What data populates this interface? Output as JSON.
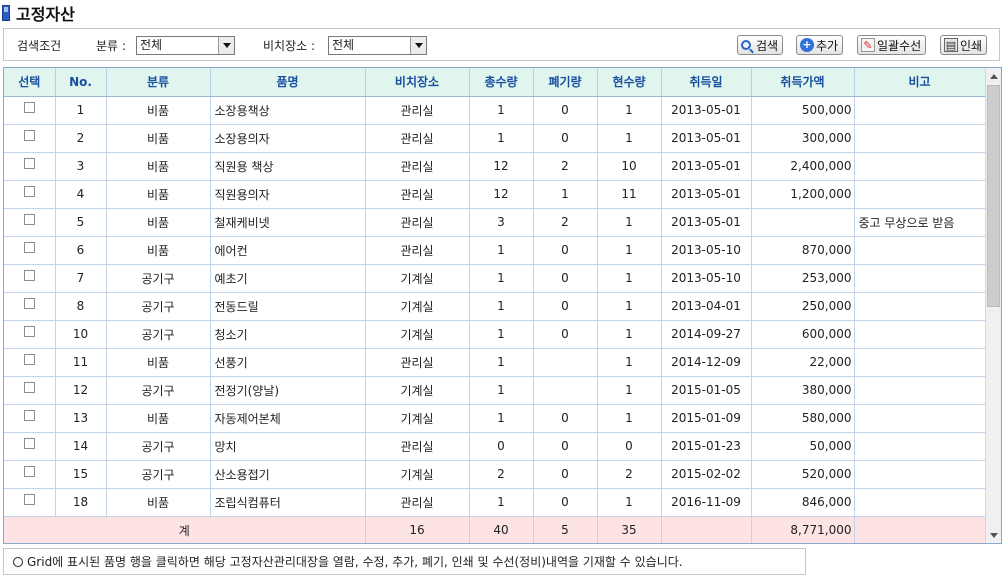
{
  "page": {
    "title": "고정자산"
  },
  "search": {
    "label": "검색조건",
    "category_label": "분류 :",
    "category_value": "전체",
    "location_label": "비치장소 :",
    "location_value": "전체"
  },
  "toolbar": {
    "search_label": "검색",
    "add_label": "추가",
    "bulk_edit_label": "일괄수선",
    "print_label": "인쇄"
  },
  "grid": {
    "columns": [
      "선택",
      "No.",
      "분류",
      "품명",
      "비치장소",
      "총수량",
      "폐기량",
      "현수량",
      "취득일",
      "취득가액",
      "비고"
    ],
    "rows": [
      {
        "no": "1",
        "category": "비품",
        "name": "소장용책상",
        "location": "관리실",
        "total": "1",
        "disposed": "0",
        "current": "1",
        "date": "2013-05-01",
        "price": "500,000",
        "note": ""
      },
      {
        "no": "2",
        "category": "비품",
        "name": "소장용의자",
        "location": "관리실",
        "total": "1",
        "disposed": "0",
        "current": "1",
        "date": "2013-05-01",
        "price": "300,000",
        "note": ""
      },
      {
        "no": "3",
        "category": "비품",
        "name": "직원용 책상",
        "location": "관리실",
        "total": "12",
        "disposed": "2",
        "current": "10",
        "date": "2013-05-01",
        "price": "2,400,000",
        "note": ""
      },
      {
        "no": "4",
        "category": "비품",
        "name": "직원용의자",
        "location": "관리실",
        "total": "12",
        "disposed": "1",
        "current": "11",
        "date": "2013-05-01",
        "price": "1,200,000",
        "note": ""
      },
      {
        "no": "5",
        "category": "비품",
        "name": "철재케비넷",
        "location": "관리실",
        "total": "3",
        "disposed": "2",
        "current": "1",
        "date": "2013-05-01",
        "price": "",
        "note": "중고 무상으로 받음"
      },
      {
        "no": "6",
        "category": "비품",
        "name": "에어컨",
        "location": "관리실",
        "total": "1",
        "disposed": "0",
        "current": "1",
        "date": "2013-05-10",
        "price": "870,000",
        "note": ""
      },
      {
        "no": "7",
        "category": "공기구",
        "name": "예초기",
        "location": "기계실",
        "total": "1",
        "disposed": "0",
        "current": "1",
        "date": "2013-05-10",
        "price": "253,000",
        "note": ""
      },
      {
        "no": "8",
        "category": "공기구",
        "name": "전동드릴",
        "location": "기계실",
        "total": "1",
        "disposed": "0",
        "current": "1",
        "date": "2013-04-01",
        "price": "250,000",
        "note": ""
      },
      {
        "no": "10",
        "category": "공기구",
        "name": "청소기",
        "location": "기계실",
        "total": "1",
        "disposed": "0",
        "current": "1",
        "date": "2014-09-27",
        "price": "600,000",
        "note": ""
      },
      {
        "no": "11",
        "category": "비품",
        "name": "선풍기",
        "location": "관리실",
        "total": "1",
        "disposed": "",
        "current": "1",
        "date": "2014-12-09",
        "price": "22,000",
        "note": ""
      },
      {
        "no": "12",
        "category": "공기구",
        "name": "전정기(양날)",
        "location": "기계실",
        "total": "1",
        "disposed": "",
        "current": "1",
        "date": "2015-01-05",
        "price": "380,000",
        "note": ""
      },
      {
        "no": "13",
        "category": "비품",
        "name": "자동제어본체",
        "location": "기계실",
        "total": "1",
        "disposed": "0",
        "current": "1",
        "date": "2015-01-09",
        "price": "580,000",
        "note": ""
      },
      {
        "no": "14",
        "category": "공기구",
        "name": "망치",
        "location": "관리실",
        "total": "0",
        "disposed": "0",
        "current": "0",
        "date": "2015-01-23",
        "price": "50,000",
        "note": ""
      },
      {
        "no": "15",
        "category": "공기구",
        "name": "산소용접기",
        "location": "기계실",
        "total": "2",
        "disposed": "0",
        "current": "2",
        "date": "2015-02-02",
        "price": "520,000",
        "note": ""
      },
      {
        "no": "18",
        "category": "비품",
        "name": "조립식컴퓨터",
        "location": "관리실",
        "total": "1",
        "disposed": "0",
        "current": "1",
        "date": "2016-11-09",
        "price": "846,000",
        "note": ""
      }
    ],
    "totals": {
      "label": "계",
      "count": "16",
      "total": "40",
      "disposed": "5",
      "current": "35",
      "price": "8,771,000"
    }
  },
  "footer": {
    "note": "Grid에 표시된 품명 행을 클릭하면 해당 고정자산관리대장을 열람, 수정, 추가, 폐기, 인쇄 및 수선(정비)내역을 기재할 수 있습니다."
  }
}
